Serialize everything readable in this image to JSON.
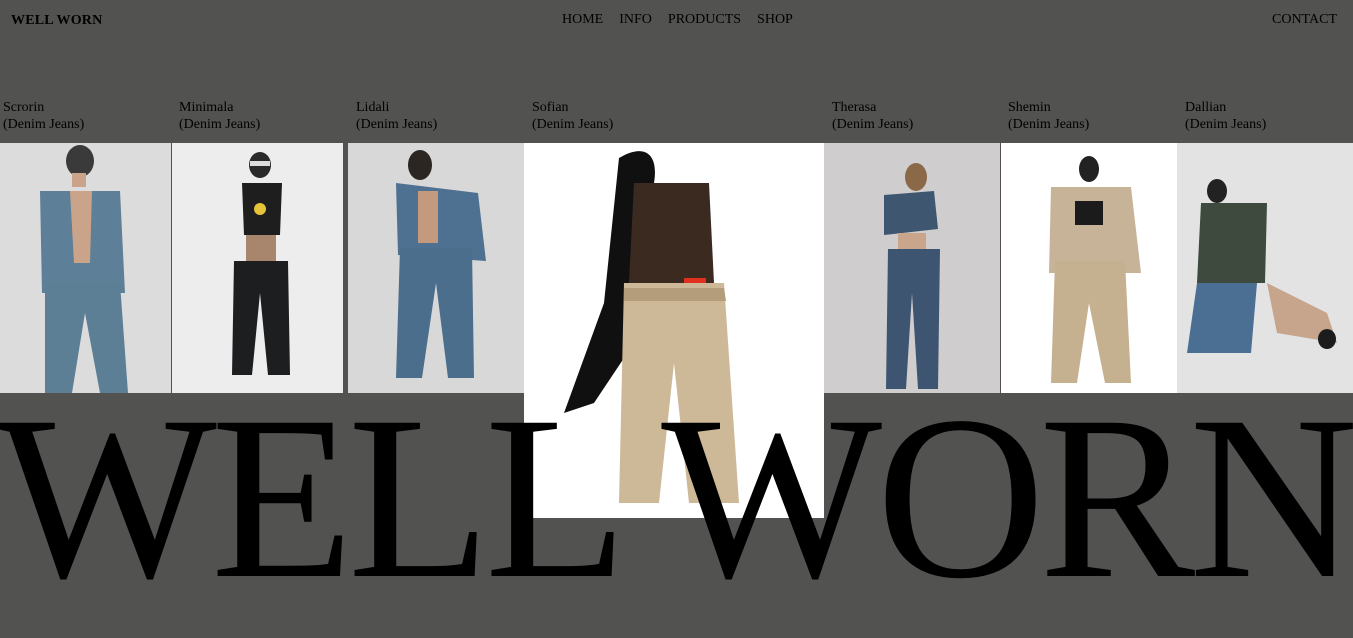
{
  "header": {
    "logo": "WELL WORN",
    "nav": [
      "HOME",
      "INFO",
      "PRODUCTS",
      "SHOP"
    ],
    "contact": "CONTACT"
  },
  "products": [
    {
      "name": "Scrorin",
      "type": "(Denim Jeans)"
    },
    {
      "name": "Minimala",
      "type": "(Denim Jeans)"
    },
    {
      "name": "Lidali",
      "type": "(Denim Jeans)"
    },
    {
      "name": "Sofian",
      "type": "(Denim Jeans)"
    },
    {
      "name": "Therasa",
      "type": "(Denim Jeans)"
    },
    {
      "name": "Shemin",
      "type": "(Denim Jeans)"
    },
    {
      "name": "Dallian",
      "type": "(Denim Jeans)"
    }
  ],
  "hero_text": "WELL WORN",
  "colors": {
    "background": "#525250",
    "photo_bg_light": "#e9e9ea",
    "denim_blue": "#4a6f8e",
    "dark_denim": "#2e3b4a",
    "khaki": "#c9b597"
  }
}
